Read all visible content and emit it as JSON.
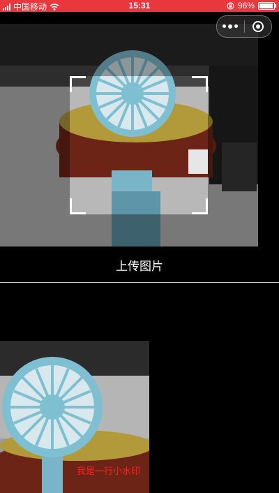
{
  "status_bar": {
    "carrier": "中国移动",
    "time": "15:31",
    "battery": "96%",
    "battery_level": 0.96
  },
  "capsule": {
    "more_icon": "more-dots-icon",
    "close_icon": "target-icon"
  },
  "upload_button": "上传图片",
  "watermark_text": "我是一行小水印",
  "colors": {
    "status_bar_bg": "#e8383d",
    "watermark": "#ff2020",
    "background": "#000000"
  }
}
